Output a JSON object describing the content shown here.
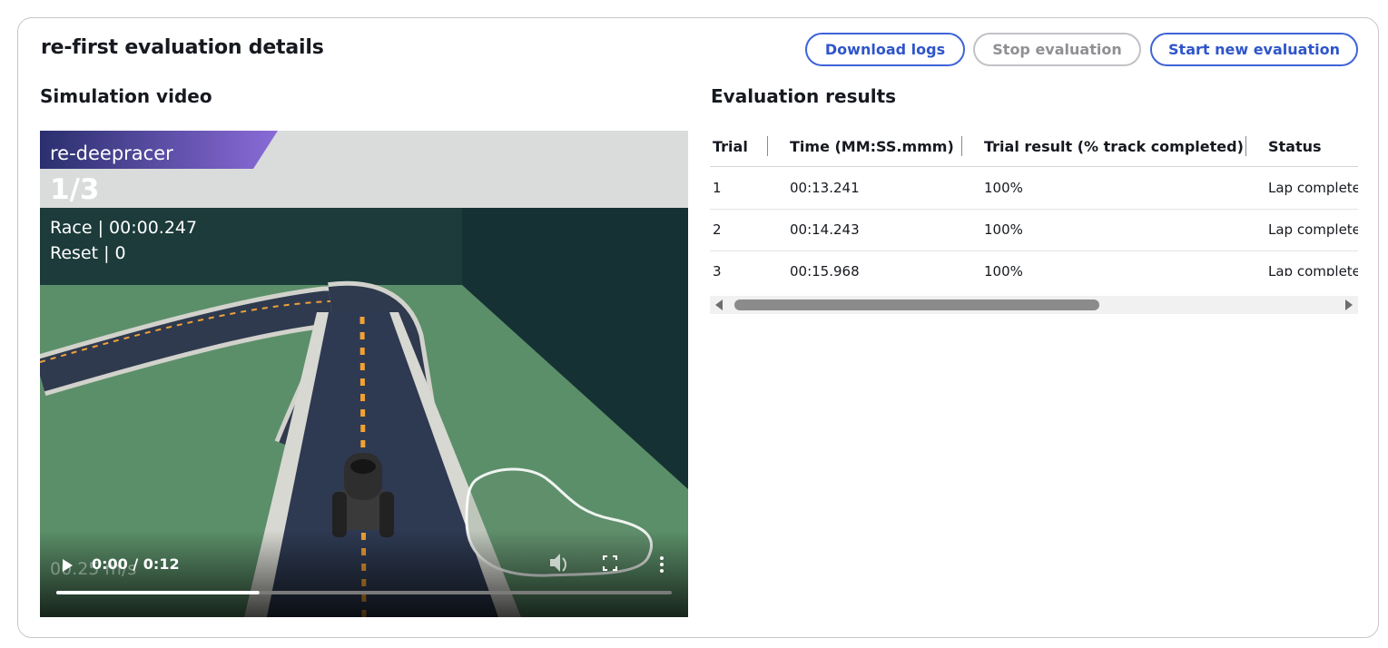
{
  "header": {
    "title": "re-first evaluation details",
    "buttons": {
      "download_logs": "Download logs",
      "stop_evaluation": "Stop evaluation",
      "start_new_evaluation": "Start new evaluation"
    }
  },
  "video": {
    "section_title": "Simulation video",
    "overlay": {
      "model_name": "re-deepracer",
      "lap": "1/3",
      "race": "Race | 00:00.247",
      "reset": "Reset | 0",
      "speed": "00.25 m/s"
    },
    "player": {
      "time": "0:00 / 0:12",
      "progress": 0.33
    }
  },
  "results": {
    "section_title": "Evaluation results",
    "columns": [
      "Trial",
      "Time (MM:SS.mmm)",
      "Trial result (% track completed)",
      "Status"
    ],
    "rows": [
      [
        "1",
        "00:13.241",
        "100%",
        "Lap complete"
      ],
      [
        "2",
        "00:14.243",
        "100%",
        "Lap complete"
      ],
      [
        "3",
        "00:15.968",
        "100%",
        "Lap complete"
      ]
    ]
  },
  "colors": {
    "primary": "#2f55c9",
    "disabled": "#8f8f94",
    "border": "#c6c6cd"
  }
}
